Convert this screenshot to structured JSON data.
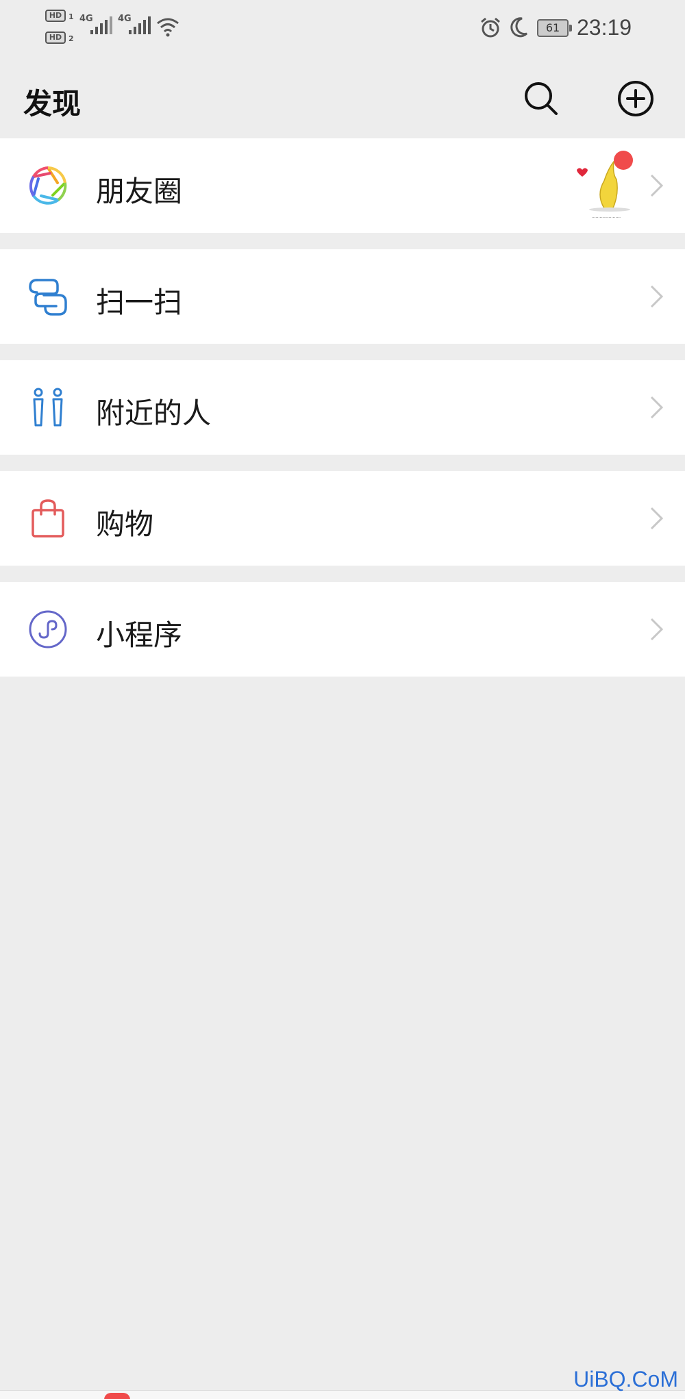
{
  "status_bar": {
    "sim1_badge": "HD",
    "sim1_num": "1",
    "sim2_badge": "HD",
    "sim2_num": "2",
    "net1": "4G",
    "net2": "4G",
    "battery": "61",
    "time": "23:19"
  },
  "header": {
    "title": "发现"
  },
  "menu": {
    "items": [
      {
        "label": "朋友圈",
        "icon": "moments-aperture-icon"
      },
      {
        "label": "扫一扫",
        "icon": "scan-icon"
      },
      {
        "label": "附近的人",
        "icon": "people-nearby-icon"
      },
      {
        "label": "购物",
        "icon": "shopping-bag-icon"
      },
      {
        "label": "小程序",
        "icon": "mini-program-icon"
      }
    ]
  },
  "colors": {
    "background": "#ededed",
    "item_bg": "#ffffff",
    "scan": "#2f7fd0",
    "nearby": "#2f7fd0",
    "shopping": "#e35b5b",
    "mini_program": "#6467c9",
    "badge": "#f04b4b"
  },
  "watermark": "UiBQ.CoM"
}
